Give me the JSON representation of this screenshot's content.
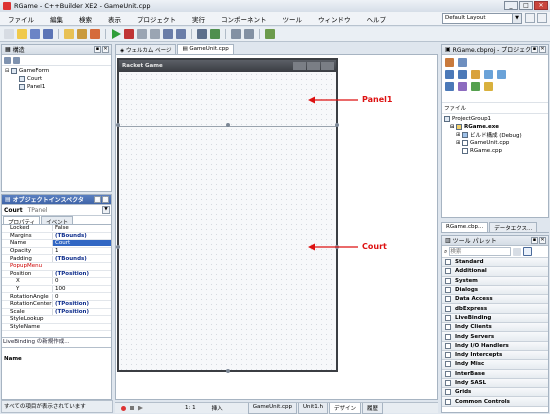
{
  "window": {
    "title": "RGame - C++Builder XE2 - GameUnit.cpp"
  },
  "menu": [
    "ファイル",
    "編集",
    "検索",
    "表示",
    "プロジェクト",
    "実行",
    "コンポーネント",
    "ツール",
    "ウィンドウ",
    "ヘルプ"
  ],
  "layout_select": "Default Layout",
  "structure": {
    "title": "構造",
    "items": [
      "GameForm",
      "Court",
      "Panel1"
    ]
  },
  "inspector": {
    "title": "オブジェクトインスペクタ",
    "object_name": "Court",
    "object_type": "TPanel",
    "tabs": [
      "プロパティ",
      "イベント"
    ],
    "rows": [
      {
        "k": "Locked",
        "v": "False",
        "kb": false,
        "vs": "check"
      },
      {
        "k": "Margins",
        "v": "(TBounds)",
        "vs": "bold"
      },
      {
        "k": "Name",
        "v": "Court",
        "vs": "sel"
      },
      {
        "k": "Opacity",
        "v": "1"
      },
      {
        "k": "Padding",
        "v": "(TBounds)",
        "vs": "bold"
      },
      {
        "k": "PopupMenu",
        "v": "",
        "ks": "red"
      },
      {
        "k": "Position",
        "v": "(TPosition)",
        "vs": "bold"
      },
      {
        "k": "X",
        "v": "0"
      },
      {
        "k": "Y",
        "v": "100"
      },
      {
        "k": "RotationAngle",
        "v": "0"
      },
      {
        "k": "RotationCenter",
        "v": "(TPosition)",
        "vs": "bold"
      },
      {
        "k": "Scale",
        "v": "(TPosition)",
        "vs": "bold"
      },
      {
        "k": "StyleLookup",
        "v": ""
      },
      {
        "k": "StyleName",
        "v": ""
      }
    ],
    "hint": "LiveBinding の新規作成...",
    "desc_name": "Name",
    "status": "すべての項目が表示されています"
  },
  "doc_tabs": [
    "ウェルカム ページ",
    "GameUnit.cpp"
  ],
  "form": {
    "caption": "Racket Game"
  },
  "annotations": {
    "panel1": "Panel1",
    "court": "Court"
  },
  "editor_status": {
    "pos": "1:  1",
    "mode": "挿入",
    "tabs": [
      "GameUnit.cpp",
      "Unit1.h",
      "デザイン",
      "履歴"
    ]
  },
  "project": {
    "title": "RGame.cbproj - プロジェクト...",
    "file_label": "ファイル",
    "items": [
      "ProjectGroup1",
      "RGame.exe",
      "ビルド構成 (Debug)",
      "GameUnit.cpp",
      "RGame.cpp"
    ],
    "tabs": [
      "RGame.cbp...",
      "データエクス..."
    ]
  },
  "palette": {
    "title": "ツール パレット",
    "search_placeholder": "検索",
    "items": [
      "Standard",
      "Additional",
      "System",
      "Dialogs",
      "Data Access",
      "dbExpress",
      "LiveBinding",
      "Indy Clients",
      "Indy Servers",
      "Indy I/O Handlers",
      "Indy Intercepts",
      "Indy Misc",
      "InterBase",
      "Indy SASL",
      "Grids",
      "Common Controls"
    ]
  }
}
